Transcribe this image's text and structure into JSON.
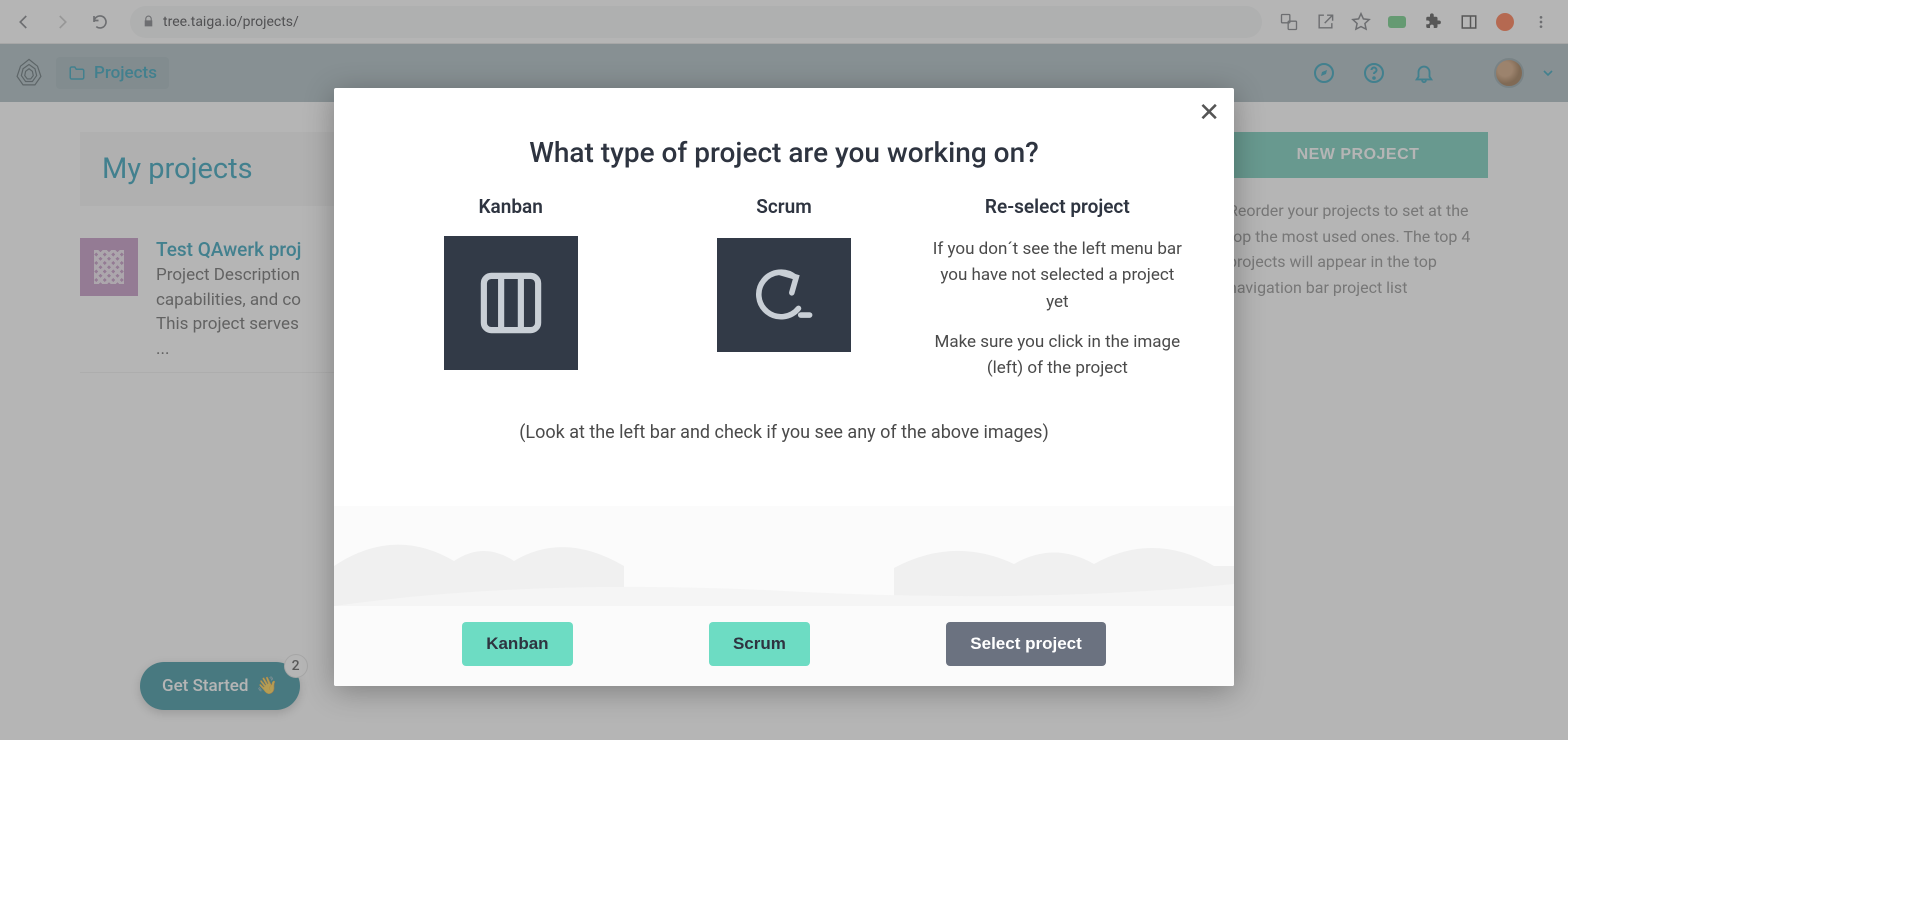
{
  "browser": {
    "url": "tree.taiga.io/projects/"
  },
  "header": {
    "crumb": "Projects"
  },
  "main": {
    "title": "My projects",
    "project": {
      "name": "Test QAwerk proj",
      "desc1": "Project Description",
      "desc2": "capabilities, and co",
      "desc3": "This project serves",
      "ellipsis": "..."
    },
    "new_project_label": "NEW PROJECT",
    "reorder": "Reorder your projects to set at the top the most used ones. The top 4 projects will appear in the top navigation bar project list"
  },
  "get_started": {
    "label": "Get Started",
    "badge": "2"
  },
  "modal": {
    "title": "What type of project are you working on?",
    "col1_heading": "Kanban",
    "col2_heading": "Scrum",
    "col3_heading": "Re-select project",
    "reselect1": "If you don´t see the left menu bar you have not selected a project yet",
    "reselect2": "Make sure you click in the image (left) of the project",
    "hint": "(Look at the left bar and check if you see any of the above images)",
    "btn_kanban": "Kanban",
    "btn_scrum": "Scrum",
    "btn_select": "Select project"
  }
}
